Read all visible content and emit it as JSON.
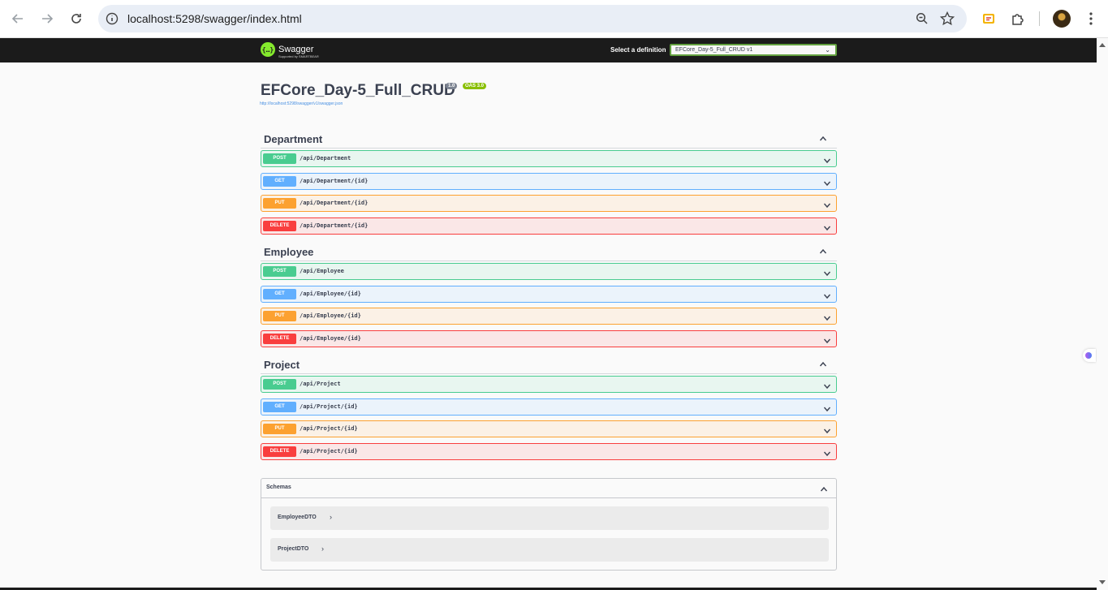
{
  "browser": {
    "url": "localhost:5298/swagger/index.html",
    "icons": [
      "back-arrow-icon",
      "forward-arrow-icon",
      "reload-icon",
      "site-info-icon",
      "zoom-icon",
      "bookmark-star-icon",
      "extension-icon",
      "puzzle-icon",
      "avatar",
      "more-menu-icon"
    ]
  },
  "topbar": {
    "logo_text": "Swagger",
    "logo_sub": "Supported by SMARTBEAR",
    "select_label": "Select a definition",
    "selected_definition": "EFCore_Day-5_Full_CRUD v1"
  },
  "info": {
    "title": "EFCore_Day-5_Full_CRUD",
    "version": "1.0",
    "oas": "OAS 3.0",
    "spec_url": "http://localhost:5298/swagger/v1/swagger.json"
  },
  "tags": [
    {
      "name": "Department",
      "operations": [
        {
          "method": "POST",
          "path": "/api/Department"
        },
        {
          "method": "GET",
          "path": "/api/Department/{id}"
        },
        {
          "method": "PUT",
          "path": "/api/Department/{id}"
        },
        {
          "method": "DELETE",
          "path": "/api/Department/{id}"
        }
      ]
    },
    {
      "name": "Employee",
      "operations": [
        {
          "method": "POST",
          "path": "/api/Employee"
        },
        {
          "method": "GET",
          "path": "/api/Employee/{id}"
        },
        {
          "method": "PUT",
          "path": "/api/Employee/{id}"
        },
        {
          "method": "DELETE",
          "path": "/api/Employee/{id}"
        }
      ]
    },
    {
      "name": "Project",
      "operations": [
        {
          "method": "POST",
          "path": "/api/Project"
        },
        {
          "method": "GET",
          "path": "/api/Project/{id}"
        },
        {
          "method": "PUT",
          "path": "/api/Project/{id}"
        },
        {
          "method": "DELETE",
          "path": "/api/Project/{id}"
        }
      ]
    }
  ],
  "schemas": {
    "title": "Schemas",
    "models": [
      "EmployeeDTO",
      "ProjectDTO"
    ]
  },
  "colors": {
    "post": "#49cc90",
    "get": "#61affe",
    "put": "#fca130",
    "delete": "#f93e3e",
    "topbar": "#1b1b1b"
  }
}
